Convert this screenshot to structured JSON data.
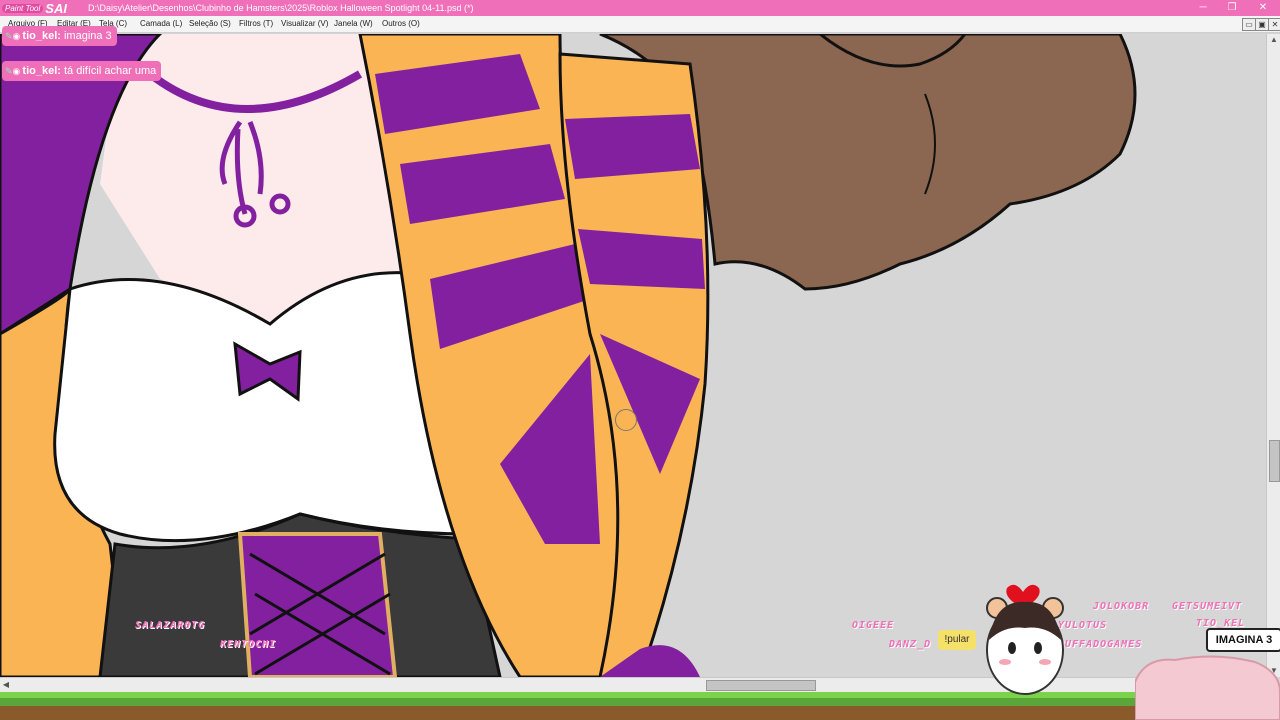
{
  "window": {
    "app_logo_small": "Paint Tool",
    "app_logo_big": "SAI",
    "file_path": "D:\\Daisy\\Atelier\\Desenhos\\Clubinho de Hamsters\\2025\\Roblox Halloween Spotlight 04-11.psd (*)"
  },
  "window_controls": {
    "minimize": "─",
    "maximize": "❐",
    "close": "✕"
  },
  "mdi_controls": {
    "minimize": "▭",
    "restore": "▣",
    "close": "✕"
  },
  "menu": [
    "Arquivo (F)",
    "Editar (E)",
    "Tela (C)",
    "Camada (L)",
    "Seleção (S)",
    "Filtros (T)",
    "Visualizar (V)",
    "Janela (W)",
    "Outros (O)"
  ],
  "chat": [
    {
      "user": "tio_kel:",
      "text": "imagina 3"
    },
    {
      "user": "tio_kel:",
      "text": "tá difícil achar uma"
    }
  ],
  "viewers": [
    "SALAZAR0TG",
    "KENTOCHI",
    "OIGEEE",
    "DANZ_D",
    "JOLOKOBR",
    "GETSUMEIVT",
    "YULOTUS",
    "BUFFADOGAMES",
    "TIO_KEL"
  ],
  "overlay": {
    "badge_text": "IMAGINA 3",
    "bubble_text": "!pular"
  },
  "scrollbars": {
    "up": "▲",
    "down": "▼",
    "left": "◀",
    "right": "▶"
  },
  "colors": {
    "titlebar": "#f06fb9",
    "purple": "#8220a0",
    "orange": "#fbb454",
    "hair": "#8b6650",
    "skin": "#fdeaea",
    "shirt": "#ffffff",
    "corset": "#3a3a3a",
    "canvas_bg": "#d6d6d6"
  }
}
